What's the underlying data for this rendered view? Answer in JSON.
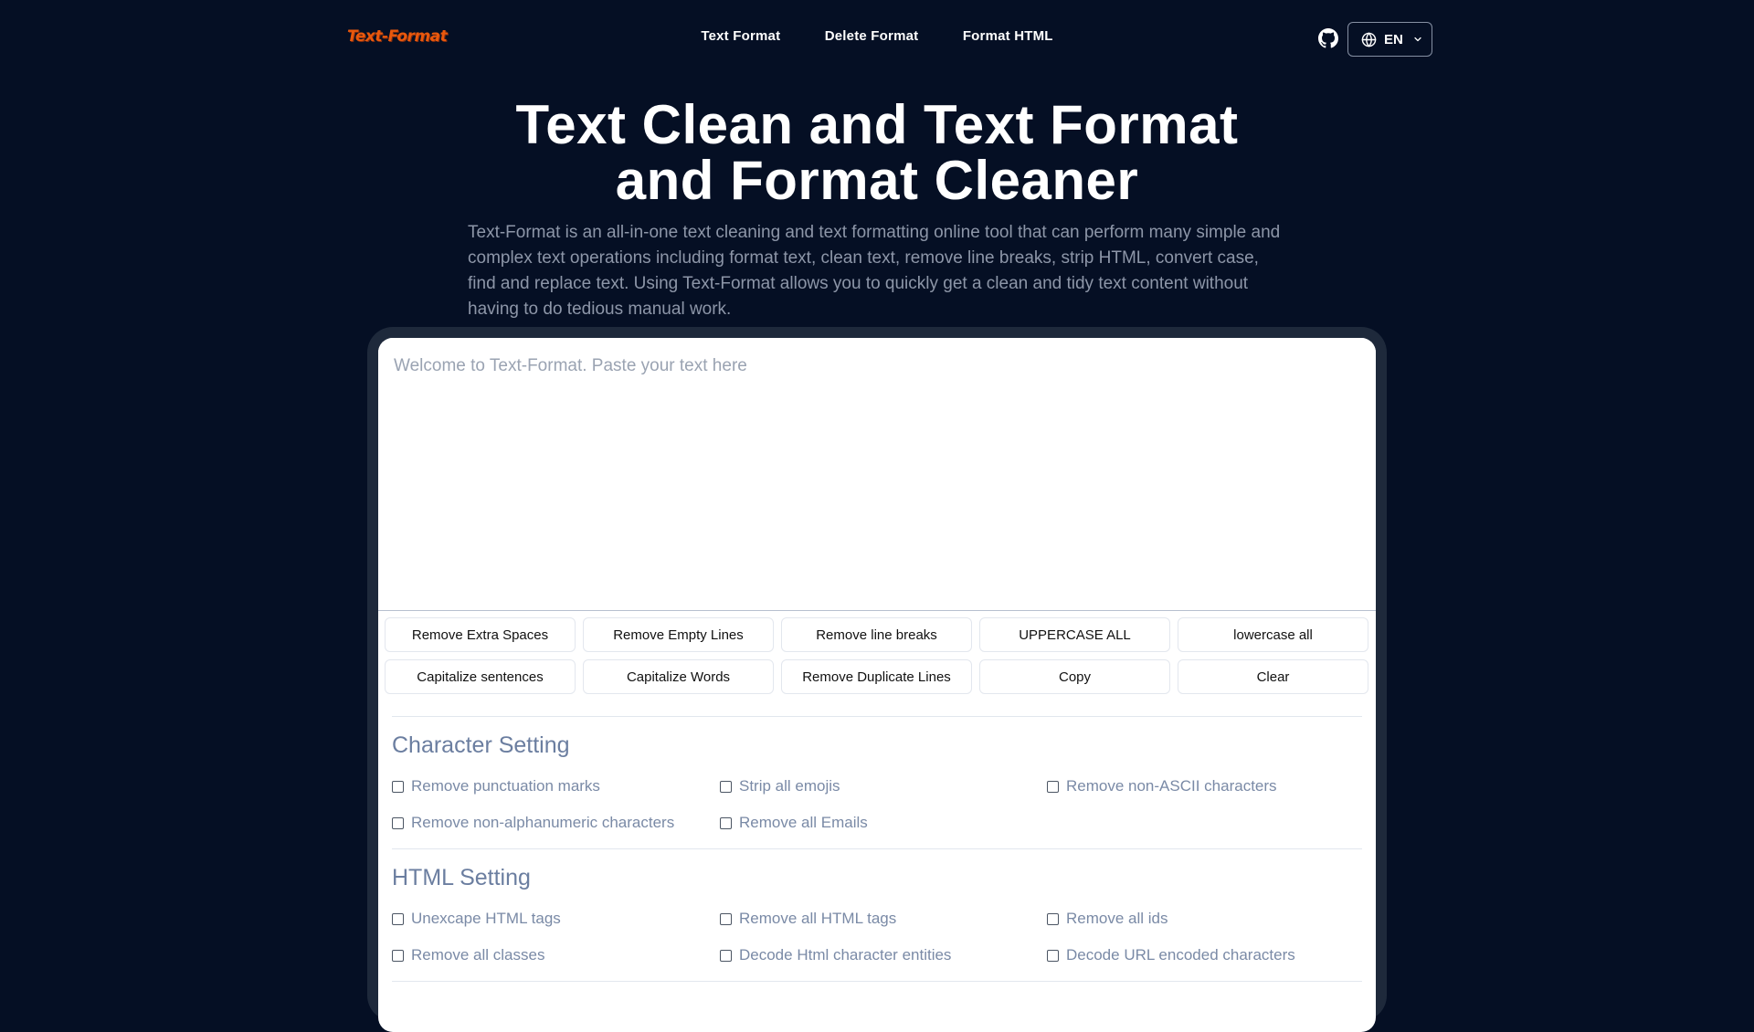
{
  "brand": {
    "logo_text": "Text-Format"
  },
  "nav": {
    "links": [
      "Text Format",
      "Delete Format",
      "Format HTML"
    ],
    "language": "EN"
  },
  "hero": {
    "title_line1": "Text Clean and Text Format",
    "title_line2": "and Format Cleaner",
    "description": "Text-Format is an all-in-one text cleaning and text formatting online tool that can perform many simple and complex text operations including format text, clean text, remove line breaks, strip HTML, convert case, find and replace text. Using Text-Format allows you to quickly get a clean and tidy text content without having to do tedious manual work."
  },
  "editor": {
    "placeholder": "Welcome to Text-Format. Paste your text here",
    "value": ""
  },
  "actions": [
    "Remove Extra Spaces",
    "Remove Empty Lines",
    "Remove line breaks",
    "UPPERCASE ALL",
    "lowercase all",
    "Capitalize sentences",
    "Capitalize Words",
    "Remove Duplicate Lines",
    "Copy",
    "Clear"
  ],
  "character_setting": {
    "title": "Character Setting",
    "options": [
      "Remove punctuation marks",
      "Strip all emojis",
      "Remove non-ASCII characters",
      "Remove non-alphanumeric characters",
      "Remove all Emails"
    ]
  },
  "html_setting": {
    "title": "HTML Setting",
    "options": [
      "Unexcape HTML tags",
      "Remove all HTML tags",
      "Remove all ids",
      "Remove all classes",
      "Decode Html character entities",
      "Decode URL encoded characters"
    ]
  },
  "colors": {
    "background": "#050f24",
    "panel": "#1e293b",
    "accent": "#ea580c",
    "muted_text": "#8d96a8",
    "section_title": "#6b7ea0"
  }
}
